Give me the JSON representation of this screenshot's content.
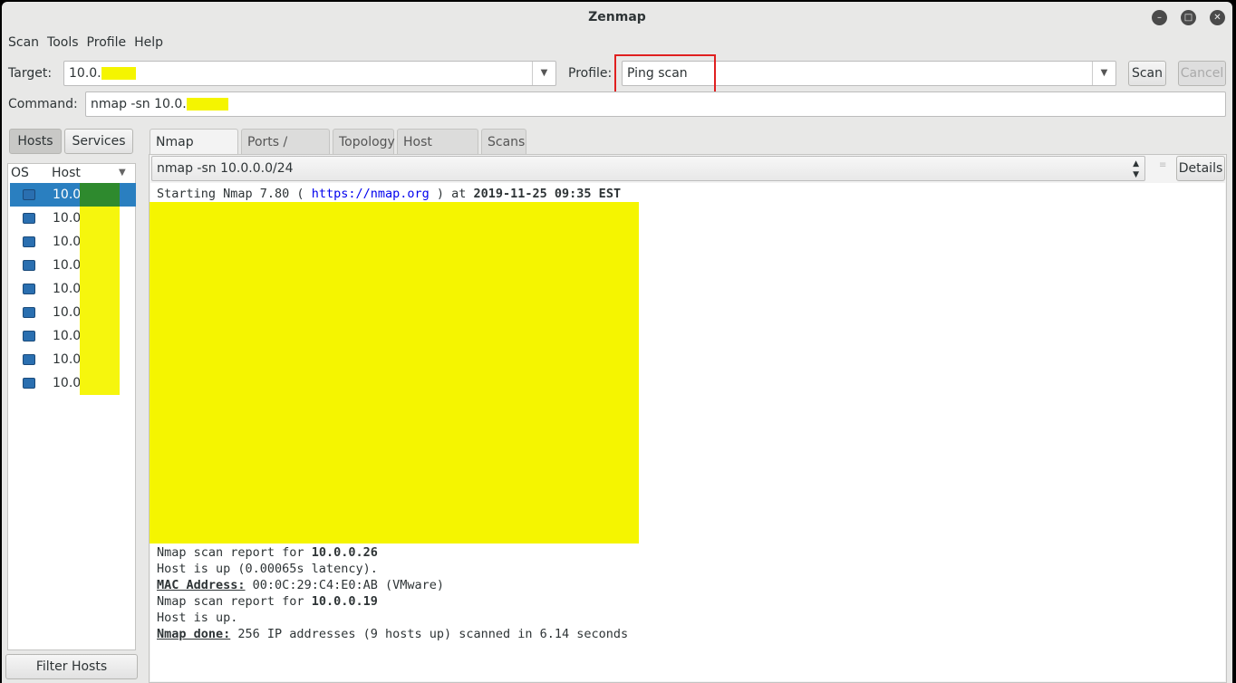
{
  "window": {
    "title": "Zenmap"
  },
  "menu": [
    "Scan",
    "Tools",
    "Profile",
    "Help"
  ],
  "target": {
    "label": "Target:",
    "value": "10.0."
  },
  "profile": {
    "label": "Profile:",
    "value": "Ping scan"
  },
  "buttons": {
    "scan": "Scan",
    "cancel": "Cancel",
    "details": "Details",
    "filter_hosts": "Filter Hosts"
  },
  "command": {
    "label": "Command:",
    "value": "nmap -sn 10.0."
  },
  "left_tabs": [
    "Hosts",
    "Services"
  ],
  "host_columns": {
    "os": "OS",
    "host": "Host"
  },
  "hosts": [
    "10.0",
    "10.0",
    "10.0",
    "10.0",
    "10.0",
    "10.0",
    "10.0",
    "10.0",
    "10.0"
  ],
  "tabs": [
    "Nmap Output",
    "Ports / Hosts",
    "Topology",
    "Host Details",
    "Scans"
  ],
  "scan_select": "nmap -sn 10.0.0.0/24",
  "output": {
    "start_pre": "Starting Nmap 7.80 ( ",
    "start_link": "https://nmap.org",
    "start_mid": " ) at ",
    "start_date": "2019-11-25 09:35 EST",
    "report_label": "Nmap scan report for ",
    "ip26": "10.0.0.26",
    "up26": "Host is up (0.00065s latency).",
    "mac_label": "MAC Address:",
    "mac_value": " 00:0C:29:C4:E0:AB (VMware)",
    "ip19": "10.0.0.19",
    "up19": "Host is up.",
    "done_label": "Nmap done:",
    "done_value": " 256 IP addresses (9 hosts up) scanned in 6.14 seconds"
  },
  "colors": {
    "highlight": "#f5f500",
    "selection": "#2a7fc0",
    "annotation_box": "#e02020",
    "link": "#0000ee"
  }
}
